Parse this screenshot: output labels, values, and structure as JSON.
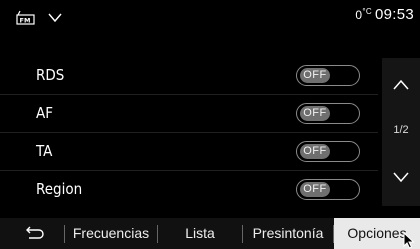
{
  "status": {
    "source_icon": "fm-radio-icon",
    "temperature": "0",
    "temp_unit": "°C",
    "time": "09:53"
  },
  "settings": [
    {
      "label": "RDS",
      "state": "OFF"
    },
    {
      "label": "AF",
      "state": "OFF"
    },
    {
      "label": "TA",
      "state": "OFF"
    },
    {
      "label": "Region",
      "state": "OFF"
    }
  ],
  "scroll": {
    "page": "1/2"
  },
  "tabs": [
    {
      "label": "Frecuencias"
    },
    {
      "label": "Lista"
    },
    {
      "label": "Presintonía"
    },
    {
      "label": "Opciones",
      "active": true
    }
  ],
  "colors": {
    "toggle_knob": "#6f6f6f",
    "active_tab_bg": "#e9e9e9"
  }
}
